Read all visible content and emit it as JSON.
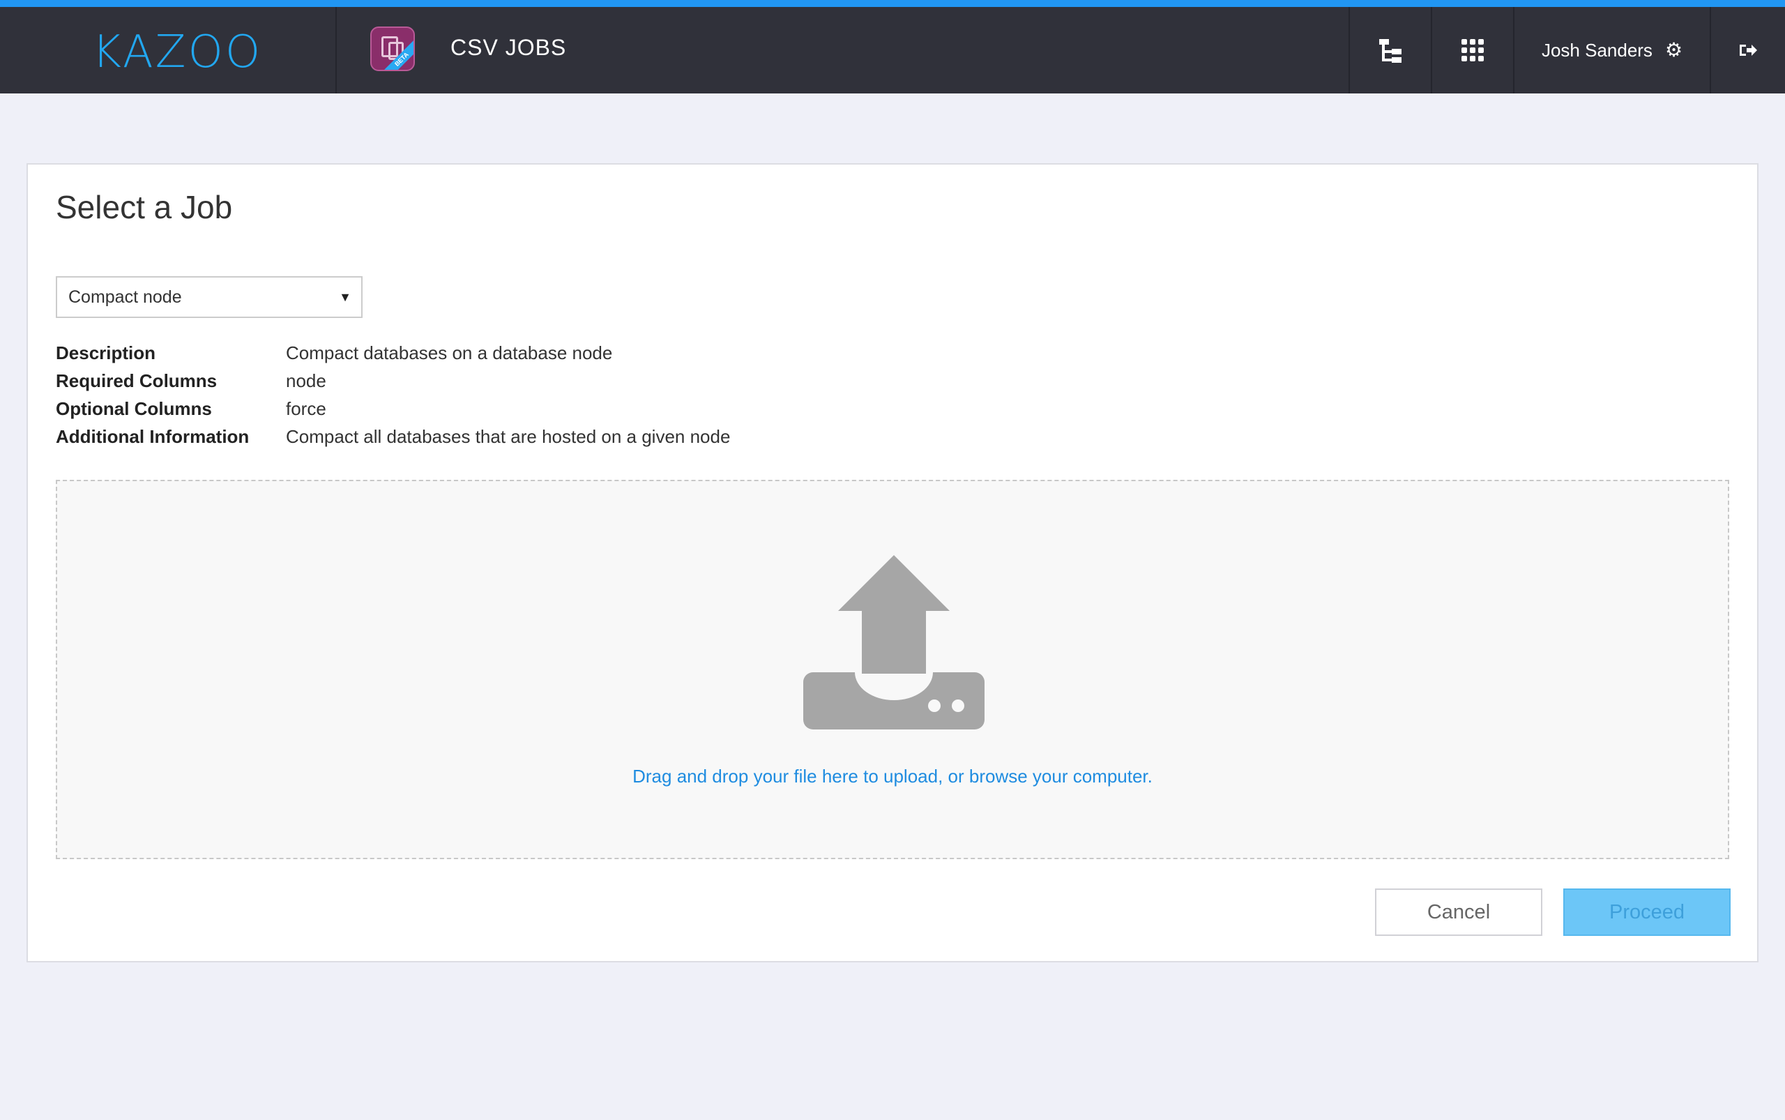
{
  "colors": {
    "accent": "#2196f3",
    "topbar": "#30313a",
    "link": "#1f8ce0",
    "proceed_bg": "#6cc6f7",
    "app_icon": "#8a2e6a"
  },
  "header": {
    "logo": "KAZOO",
    "app_icon": "csv-jobs-app-icon",
    "app_badge": "BETA",
    "app_title": "CSV JOBS",
    "user_name": "Josh Sanders",
    "icons": [
      "account-tree-icon",
      "apps-grid-icon",
      "gear-icon",
      "logout-icon"
    ]
  },
  "main": {
    "title": "Select a Job",
    "job_select": {
      "selected": "Compact node"
    },
    "details": [
      {
        "label": "Description",
        "value": "Compact databases on a database node"
      },
      {
        "label": "Required Columns",
        "value": "node"
      },
      {
        "label": "Optional Columns",
        "value": "force"
      },
      {
        "label": "Additional Information",
        "value": "Compact all databases that are hosted on a given node"
      }
    ],
    "dropzone": {
      "icon": "upload-icon",
      "text": "Drag and drop your file here to upload, or browse your computer."
    },
    "buttons": {
      "cancel": "Cancel",
      "proceed": "Proceed"
    }
  }
}
